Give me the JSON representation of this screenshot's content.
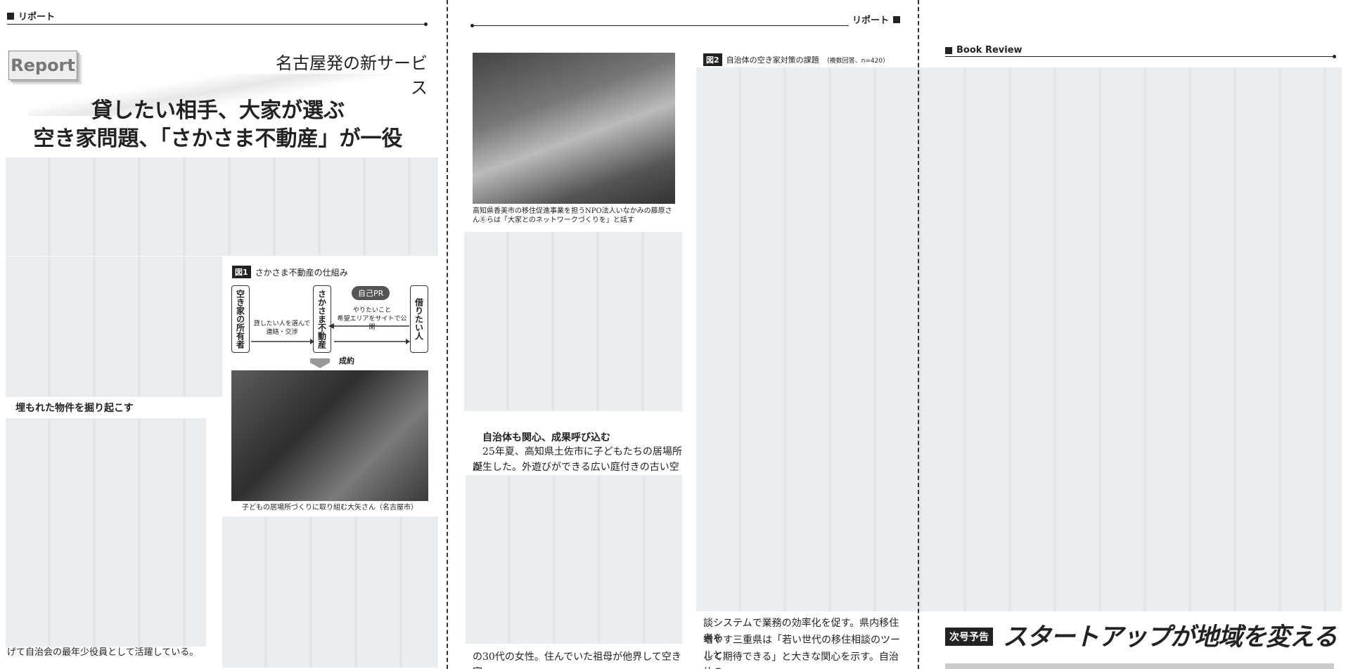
{
  "left_page": {
    "section": "リポート",
    "report_logo": "Report",
    "kicker": "名古屋発の新サービス",
    "headline_line1": "貸したい相手、大家が選ぶ",
    "headline_line2": "空き家問題、「さかさま不動産」が一役",
    "subhead": "埋もれた物件を掘り起こす",
    "bottom_text": "げて自治会の最年少役員として活躍している。",
    "figure1": {
      "label": "図1",
      "title": "さかさま不動産の仕組み",
      "owner": "空き家の所有者",
      "platform": "さかさま不動産",
      "renter": "借りたい人",
      "self_pr": "自己PR",
      "flow_top_1": "やりたいこと",
      "flow_top_2": "希望エリアをサイトで公開",
      "flow_bottom_1": "貸したい人を選んで",
      "flow_bottom_2": "連絡・交渉",
      "result": "成約"
    },
    "photo_caption": "子どもの居場所づくりに取り組む大矢さん（名古屋市）"
  },
  "middle_page": {
    "section": "リポート",
    "photo_caption": "高知県香美市の移住促進事業を担うNPO法人いなかみの藤原さん⑥らは「大家とのネットワークづくりを」と話す",
    "subhead": "自治体も関心、成果呼び込む",
    "para_line1": "25年夏、高知県土佐市に子どもたちの居場所が",
    "para_line2": "誕生した。外遊びができる広い庭付きの古い空き",
    "bottom_line": "の30代の女性。住んでいた祖母が他界して空き家",
    "figure2": {
      "label": "図2",
      "title": "自治体の空き家対策の課題",
      "note": "（複数回答、n=420）"
    },
    "right_col_line1": "談システムで業務の効率化を促す。県内移住者を",
    "right_col_line2": "増やす三重県は「若い世代の移住相談のツールと",
    "right_col_line3": "して期待できる」と大きな関心を示す。自治体の"
  },
  "right_page": {
    "section": "Book Review",
    "next_badge": "次号予告",
    "next_title": "スタートアップが地域を変える"
  }
}
